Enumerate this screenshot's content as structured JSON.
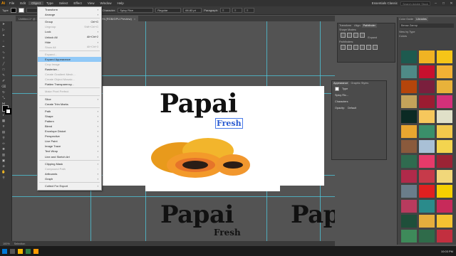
{
  "app": {
    "logo": "Ai"
  },
  "menubar": {
    "items": [
      "File",
      "Edit",
      "Object",
      "Type",
      "Select",
      "Effect",
      "View",
      "Window",
      "Help"
    ],
    "workspace": "Essentials Classic",
    "search_placeholder": "Search Adobe Stock"
  },
  "controlbar": {
    "type_label": "Type",
    "opacity_label": "Opacity:",
    "opacity_value": "100%",
    "character_label": "Character:",
    "font_name": "Spicy Rice",
    "font_style": "Regular",
    "font_size": "66.83 pt",
    "paragraph_label": "Paragraph:"
  },
  "tabs": [
    {
      "label": "Untitled-1* @ 100% (RGB/GPU Preview)"
    },
    {
      "label": "Untitled-2* @ 100% (RGB/GPU Preview)"
    }
  ],
  "object_menu": {
    "items": [
      {
        "label": "Transform",
        "submenu": true
      },
      {
        "label": "Arrange",
        "submenu": true
      },
      {
        "sep": true
      },
      {
        "label": "Group",
        "shortcut": "Ctrl+G"
      },
      {
        "label": "Ungroup",
        "shortcut": "Shift+Ctrl+G",
        "disabled": true
      },
      {
        "label": "Lock",
        "submenu": true
      },
      {
        "label": "Unlock All",
        "shortcut": "Alt+Ctrl+2"
      },
      {
        "label": "Hide",
        "submenu": true
      },
      {
        "label": "Show All",
        "shortcut": "Alt+Ctrl+3",
        "disabled": true
      },
      {
        "sep": true
      },
      {
        "label": "Expand...",
        "disabled": true
      },
      {
        "label": "Expand Appearance",
        "highlight": true
      },
      {
        "label": "Crop Image",
        "disabled": true
      },
      {
        "label": "Rasterize..."
      },
      {
        "label": "Create Gradient Mesh...",
        "disabled": true
      },
      {
        "label": "Create Object Mosaic...",
        "disabled": true
      },
      {
        "label": "Flatten Transparency..."
      },
      {
        "sep": true
      },
      {
        "label": "Make Pixel Perfect",
        "disabled": true
      },
      {
        "sep": true
      },
      {
        "label": "Slice",
        "submenu": true
      },
      {
        "label": "Create Trim Marks"
      },
      {
        "sep": true
      },
      {
        "label": "Path",
        "submenu": true
      },
      {
        "label": "Shape",
        "submenu": true
      },
      {
        "label": "Pattern",
        "submenu": true
      },
      {
        "label": "Blend",
        "submenu": true
      },
      {
        "label": "Envelope Distort",
        "submenu": true
      },
      {
        "label": "Perspective",
        "submenu": true
      },
      {
        "label": "Live Paint",
        "submenu": true
      },
      {
        "label": "Image Trace",
        "submenu": true
      },
      {
        "label": "Text Wrap",
        "submenu": true
      },
      {
        "label": "Line and Sketch Art",
        "submenu": true
      },
      {
        "sep": true
      },
      {
        "label": "Clipping Mask",
        "submenu": true
      },
      {
        "label": "Compound Path",
        "submenu": true,
        "disabled": true
      },
      {
        "label": "Artboards",
        "submenu": true
      },
      {
        "label": "Graph",
        "submenu": true
      },
      {
        "sep": true
      },
      {
        "label": "Collect For Export",
        "submenu": true
      }
    ]
  },
  "artwork": {
    "title": "Papai",
    "subtitle": "Fresh"
  },
  "pathfinder": {
    "tabs": [
      "Transform",
      "Align",
      "Pathfinder"
    ],
    "shape_modes": "Shape Modes:",
    "expand": "Expand",
    "pathfinders": "Pathfinders:"
  },
  "libraries": {
    "tabs": [
      "Color Guide",
      "Libraries"
    ],
    "library_name": "Benaz Zarrop",
    "view_by": "View by Type",
    "colors_label": "Colors"
  },
  "swatch_colors": [
    "#1e5a4f",
    "#f0b323",
    "#f5c518",
    "#4f8a86",
    "#c8102e",
    "#f2b134",
    "#b5450b",
    "#7a1f3d",
    "#e8b23a",
    "#c4a35a",
    "#9b1c31",
    "#d4307a",
    "#0b2a24",
    "#f6c75c",
    "#e0e0c8",
    "#e8a630",
    "#3a8f6a",
    "#f2c94c",
    "#8a5a3c",
    "#a9c0d6",
    "#f3d44f",
    "#2f6b4f",
    "#e63a6a",
    "#9b2335",
    "#b02a4a",
    "#c63a4a",
    "#f1d77a",
    "#6a7d8a",
    "#e02020",
    "#f5d000",
    "#b83b5e",
    "#2a8b8b",
    "#c72a5a",
    "#1f4f3a",
    "#e6ae3d",
    "#f4c232",
    "#3e8a5a",
    "#2f6b4a",
    "#c22f3f"
  ],
  "appearance": {
    "tabs": [
      "Appearance",
      "Graphic Styles"
    ],
    "type_label": "Type",
    "group_label": "Spicy Ric...",
    "characters_label": "Characters",
    "opacity_label": "Opacity:",
    "opacity_value": "Default"
  },
  "status": {
    "zoom": "100%",
    "tool": "Selection"
  },
  "taskbar": {
    "time": "10:03 PM"
  }
}
